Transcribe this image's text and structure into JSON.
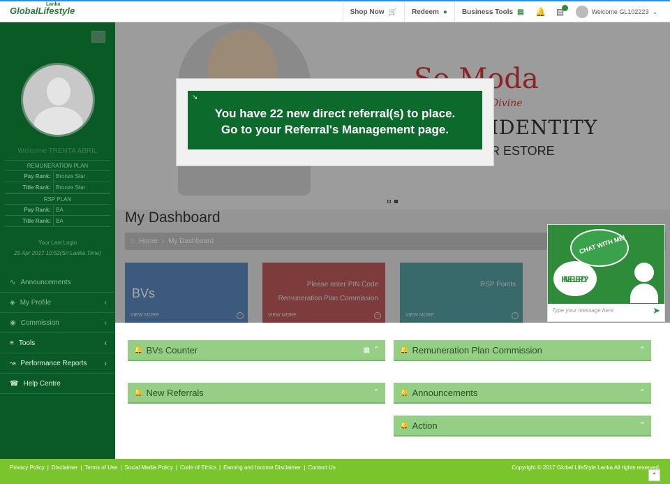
{
  "header": {
    "logo_text": "GlobalLifestyle",
    "logo_sub": "Lanka",
    "shop_now": "Shop Now",
    "redeem": "Redeem",
    "business_tools": "Business Tools",
    "welcome": "Welcome GL102223"
  },
  "sidebar": {
    "welcome": "Welcome TRENTA ABRIL",
    "remuneration_heading": "REMUNERATION PLAN",
    "pay_rank_label": "Pay Rank:",
    "pay_rank_value": "Bronze Star",
    "title_rank_label": "Title Rank:",
    "title_rank_value": "Bronze Star",
    "rsp_heading": "RSP PLAN",
    "rsp_pay_rank_label": "Pay Rank:",
    "rsp_pay_rank_value": "BA",
    "rsp_title_rank_label": "Title Rank:",
    "rsp_title_rank_value": "BA",
    "last_login_label": "Your Last Login",
    "last_login_value": "25 Apr 2017 10:52(Sri Lanka Time)",
    "menu": [
      {
        "label": "Announcements",
        "icon": "rss-icon"
      },
      {
        "label": "My Profile",
        "icon": "tag-icon"
      },
      {
        "label": "Commission",
        "icon": "globe-icon"
      },
      {
        "label": "Tools",
        "icon": "layers-icon"
      },
      {
        "label": "Performance Reports",
        "icon": "chart-line-icon"
      },
      {
        "label": "Help Centre",
        "icon": "phone-icon"
      }
    ]
  },
  "banner": {
    "brand": "So Moda",
    "tagline": "Divine",
    "identity": "IDENTITY",
    "estore": "R ESTORE"
  },
  "main": {
    "page_title": "My Dashboard",
    "breadcrumb_home": "Home",
    "breadcrumb_current": "My Dashboard"
  },
  "tiles": [
    {
      "title": "BVs",
      "line1": "",
      "line2": "",
      "view_more": "VIEW MORE"
    },
    {
      "title": "",
      "line1": "Please enter PIN Code",
      "line2": "Remuneration Plan Commission",
      "view_more": "VIEW MORE"
    },
    {
      "title": "",
      "line1": "RSP Points",
      "line2": "",
      "view_more": "VIEW MORE"
    }
  ],
  "panels": {
    "bvs_counter": "BVs Counter",
    "remuneration": "Remuneration Plan Commission",
    "new_referrals": "New Referrals",
    "announcements": "Announcements",
    "action": "Action"
  },
  "modal": {
    "line1": "You have 22 new direct referral(s) to place.",
    "line2": "Go to your Referral's Management page."
  },
  "chat": {
    "bubble1": "CHAT WITH ME!",
    "bubble2_line1": "NEED",
    "bubble2_line2": "HELP?",
    "placeholder": "Type your message here"
  },
  "footer": {
    "links": [
      "Privacy Policy",
      "Disclaimer",
      "Terms of Use",
      "Social Media Policy",
      "Code of Ethics",
      "Earning and Income Disclaimer",
      "Contact Us"
    ],
    "copyright": "Copyright © 2017 Global LifeStyle Lanka All rights reserved."
  },
  "colors": {
    "sidebar": "#0a5a26",
    "accent": "#2e8b3a",
    "footer": "#79c52b",
    "panel": "#95cf85"
  }
}
